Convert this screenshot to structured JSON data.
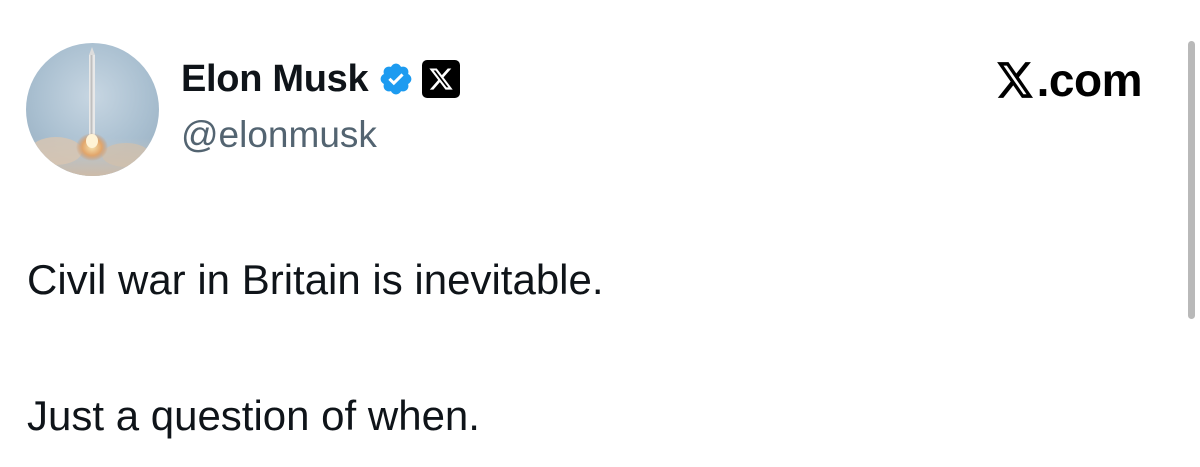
{
  "tweet": {
    "display_name": "Elon Musk",
    "handle": "@elonmusk",
    "verified_icon": "verified-badge-icon",
    "affiliate_icon": "x-logo-icon",
    "brand_text": ".com",
    "brand_icon": "x-logo-icon",
    "text_lines": [
      "Civil war in Britain is inevitable.",
      "Just a question of when."
    ]
  },
  "colors": {
    "verified": "#1d9bf0",
    "handle": "#536471",
    "text": "#0f1419"
  }
}
